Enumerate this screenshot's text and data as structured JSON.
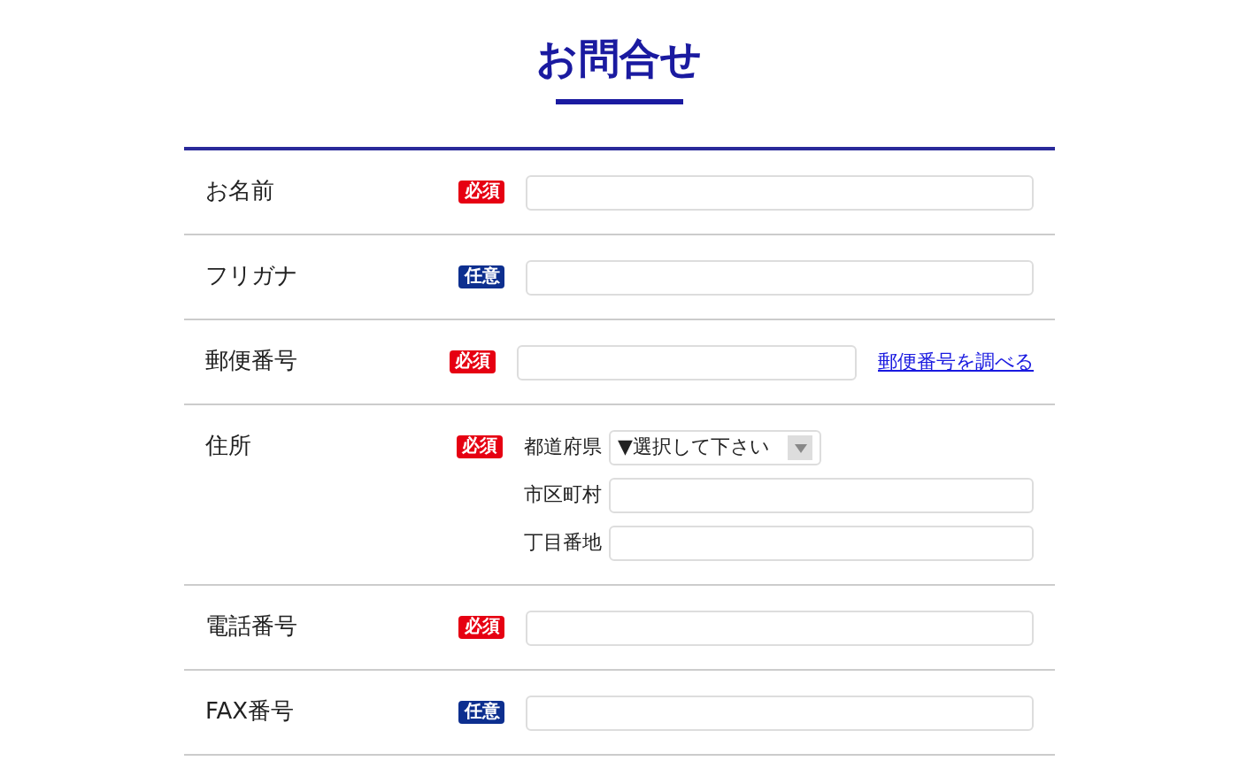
{
  "title": "お問合せ",
  "rows": [
    {
      "kind": "text",
      "label": "お名前",
      "badge": {
        "text": "必須",
        "required": true
      }
    },
    {
      "kind": "text",
      "label": "フリガナ",
      "badge": {
        "text": "任意",
        "required": false
      }
    },
    {
      "kind": "postal",
      "label": "郵便番号",
      "badge": {
        "text": "必須",
        "required": true
      },
      "link": "郵便番号を調べる"
    },
    {
      "kind": "address",
      "label": "住所",
      "badge": {
        "text": "必須",
        "required": true
      },
      "fields": [
        {
          "kind": "select",
          "label": "都道府県",
          "value": "▼選択して下さい"
        },
        {
          "kind": "text",
          "label": "市区町村"
        },
        {
          "kind": "text",
          "label": "丁目番地"
        }
      ]
    },
    {
      "kind": "text",
      "label": "電話番号",
      "badge": {
        "text": "必須",
        "required": true
      }
    },
    {
      "kind": "text",
      "label": "FAX番号",
      "badge": {
        "text": "任意",
        "required": false
      }
    }
  ]
}
